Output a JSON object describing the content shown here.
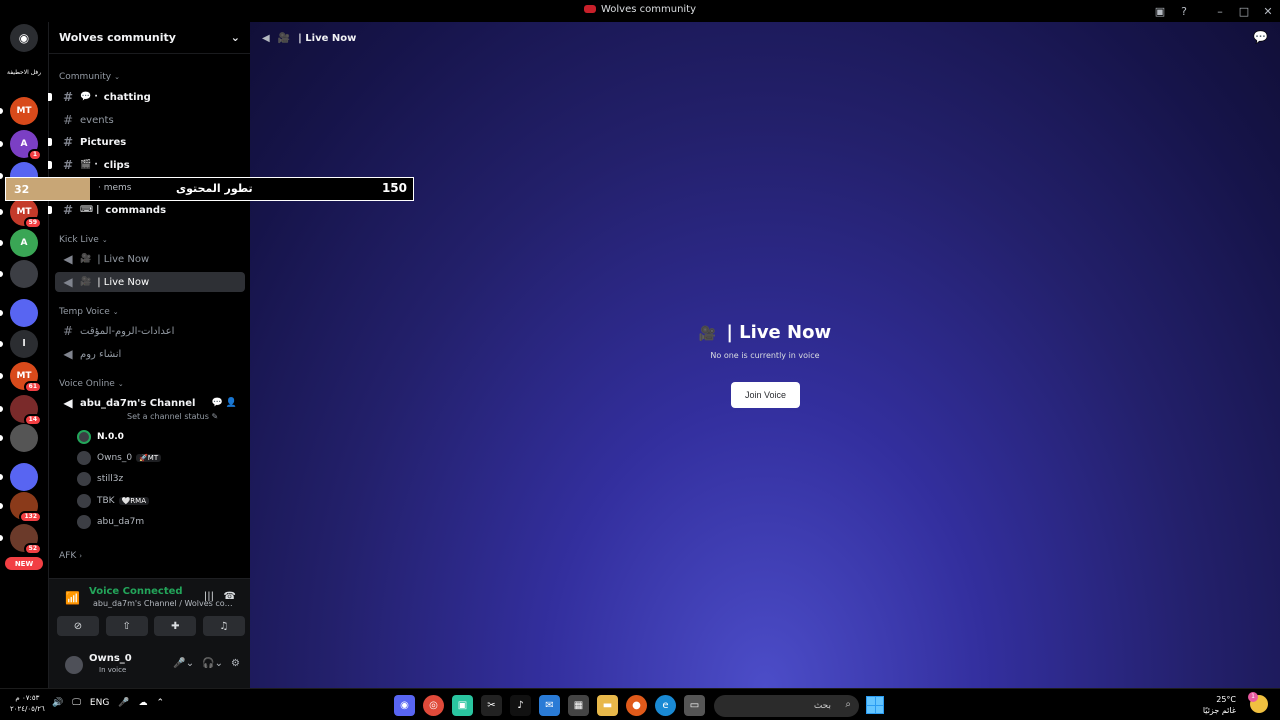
{
  "window": {
    "title": "Wolves community"
  },
  "rail": {
    "top_text": "رفل الاحطيفة",
    "servers": [
      {
        "label": "MT",
        "badge": "",
        "color": "#d84a1b"
      },
      {
        "label": "A",
        "badge": "1",
        "color": "#7b3fc4"
      },
      {
        "label": "",
        "badge": "",
        "color": "#5865f2"
      },
      {
        "label": "MT",
        "badge": "59",
        "color": "#c43a2a"
      },
      {
        "label": "A",
        "badge": "",
        "color": "#3aa655"
      },
      {
        "label": "",
        "badge": "",
        "color": "#3c3e44"
      },
      {
        "label": "",
        "badge": "",
        "color": "#5865f2"
      },
      {
        "label": "l",
        "badge": "",
        "color": "#2b2d31"
      },
      {
        "label": "MT",
        "badge": "61",
        "color": "#d84a1b"
      },
      {
        "label": "",
        "badge": "14",
        "color": "#7a2a2a"
      },
      {
        "label": "",
        "badge": "",
        "color": "#555"
      },
      {
        "label": "",
        "badge": "",
        "color": "#5865f2"
      },
      {
        "label": "",
        "badge": "132",
        "color": "#8a3a1a"
      },
      {
        "label": "",
        "badge": "52",
        "color": "#6b3a2a"
      }
    ],
    "new_label": "NEW"
  },
  "sidebar": {
    "server_name": "Wolves community",
    "categories": {
      "community": "Community",
      "kick_live": "Kick Live",
      "temp_voice": "Temp Voice",
      "voice_online": "Voice Online",
      "afk": "AFK"
    },
    "channels": {
      "chatting": "chatting",
      "events": "events",
      "pictures": "Pictures",
      "clips": "clips",
      "commands": "commands",
      "live1": "| Live Now",
      "live2": "| Live Now",
      "temp_settings": "اعدادات-الروم-المؤقت",
      "create_room": "انشاء روم",
      "voice_channel": "abu_da7m's Channel",
      "set_status": "Set a channel status"
    },
    "voice_users": [
      {
        "name": "N.0.0",
        "tag": ""
      },
      {
        "name": "Owns_0",
        "tag": "🚀MT"
      },
      {
        "name": "still3z",
        "tag": ""
      },
      {
        "name": "TBK",
        "tag": "🤍RMA"
      },
      {
        "name": "abu_da7m",
        "tag": ""
      }
    ],
    "voice_connected": {
      "status": "Voice Connected",
      "location": "abu_da7m's Channel / Wolves commun..."
    },
    "user": {
      "name": "Owns_0",
      "status": "In voice"
    }
  },
  "overlay": {
    "left_value": "32",
    "channel": "mems",
    "arabic_text": "تطور المحتوى",
    "right_value": "150"
  },
  "main": {
    "header_title": "| Live Now",
    "channel_title": "| Live Now",
    "empty_text": "No one is currently in voice",
    "join_label": "Join Voice"
  },
  "taskbar": {
    "time": "٠٧:٥٣ م",
    "date": "٢٠٢٤/٠٥/٢٦",
    "lang": "ENG",
    "search_placeholder": "بحث",
    "temperature": "25°C",
    "weather_desc": "غائم جزئيًا",
    "notification_count": "1"
  }
}
